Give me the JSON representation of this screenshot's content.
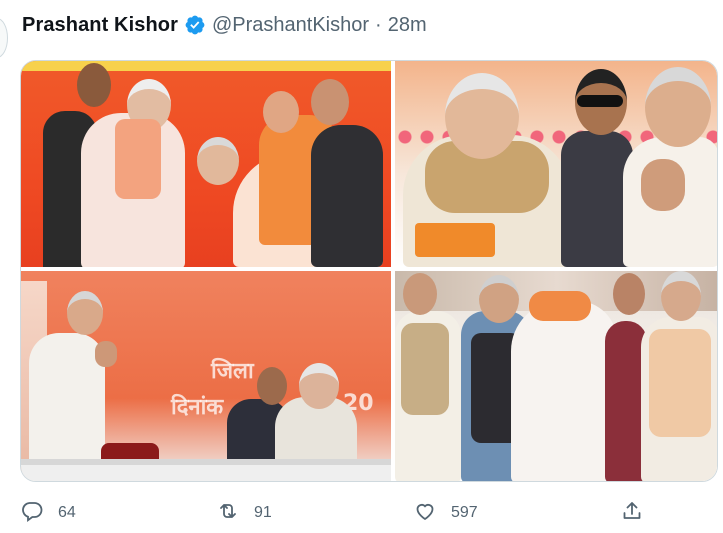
{
  "tweet": {
    "author_name": "Prashant Kishor",
    "handle": "@PrashantKishor",
    "separator": "·",
    "timestamp": "28m"
  },
  "media": {
    "photo_count": 4,
    "photo3_sign_line1": "जिला",
    "photo3_sign_line2": "दिनांक",
    "photo3_sign_suffix": "20"
  },
  "actions": {
    "replies": "64",
    "retweets": "91",
    "likes": "597"
  },
  "icons": {
    "verified": "verified-badge-icon",
    "reply": "reply-icon",
    "retweet": "retweet-icon",
    "like": "heart-icon",
    "share": "share-icon"
  },
  "colors": {
    "verified_blue": "#1d9bf0",
    "secondary_text": "#536471",
    "primary_text": "#0f1419",
    "border": "#cfd9de"
  }
}
